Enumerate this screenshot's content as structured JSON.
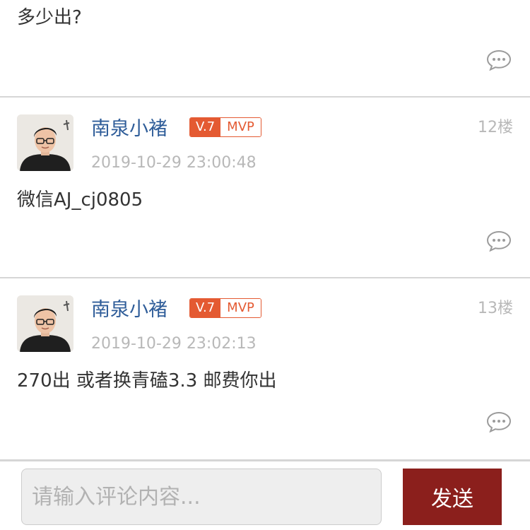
{
  "partial_comment": {
    "text": "多少出?"
  },
  "comments": [
    {
      "username": "南泉小褚",
      "level": "V.7",
      "badge": "MVP",
      "timestamp": "2019-10-29 23:00:48",
      "floor": "12楼",
      "content": "微信AJ_cj0805"
    },
    {
      "username": "南泉小褚",
      "level": "V.7",
      "badge": "MVP",
      "timestamp": "2019-10-29 23:02:13",
      "floor": "13楼",
      "content": "270出 或者换青磕3.3 邮费你出"
    }
  ],
  "input_bar": {
    "placeholder": "请输入评论内容...",
    "send_label": "发送"
  },
  "icons": {
    "reply": "speech-bubble-icon"
  },
  "colors": {
    "username": "#2f5d99",
    "badge": "#e45a32",
    "send_button": "#8b1f1c",
    "meta_text": "#b8b8b8"
  }
}
